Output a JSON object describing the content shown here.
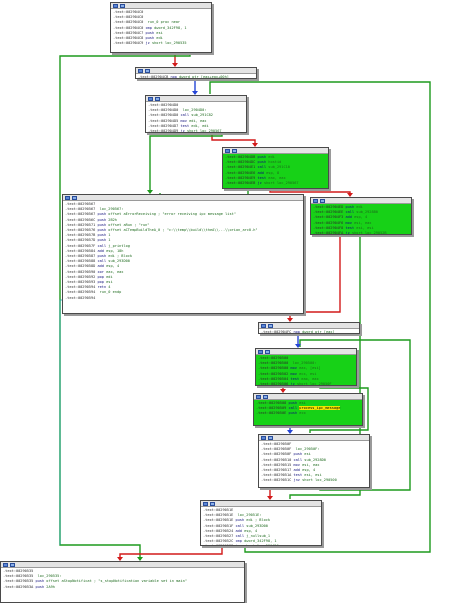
{
  "colors": {
    "edge_true": "#1d9a1d",
    "edge_false": "#d21a1a",
    "edge_uncond": "#2545d6",
    "node_green": "#17d117"
  },
  "nodes": [
    {
      "id": "n1",
      "green": false,
      "lines": [
        {
          "a": ".text:002904C0",
          "i": "",
          "o": ""
        },
        {
          "a": ".text:002904C0",
          "i": "",
          "o": ""
        },
        {
          "a": ".text:002904C0",
          "i": "",
          "o": "run_0 proc near"
        },
        {
          "a": ".text:002904C0",
          "i": "cmp",
          "o": "dword_342F98, 1"
        },
        {
          "a": ".text:002904C7",
          "i": "push",
          "o": "esi"
        },
        {
          "a": ".text:002904C8",
          "i": "push",
          "o": "edi"
        },
        {
          "a": ".text:002904C9",
          "i": "jz",
          "o": "short loc_290535"
        }
      ]
    },
    {
      "id": "n2",
      "green": false,
      "lines": [
        {
          "a": ".text:002904CB",
          "i": "nop",
          "o": "dword ptr [eax+eax+00h]"
        }
      ]
    },
    {
      "id": "n3",
      "green": false,
      "lines": [
        {
          "a": ".text:002904D0",
          "i": "",
          "o": ""
        },
        {
          "a": ".text:002904D0",
          "i": "",
          "o": "loc_2904D0:"
        },
        {
          "a": ".text:002904D0",
          "i": "call",
          "o": "sub_291C82"
        },
        {
          "a": ".text:002904D5",
          "i": "mov",
          "o": "edi, eax"
        },
        {
          "a": ".text:002904D7",
          "i": "test",
          "o": "edi, edi"
        },
        {
          "a": ".text:002904D9",
          "i": "jz",
          "o": "short loc_290567"
        }
      ]
    },
    {
      "id": "n4",
      "green": true,
      "lines": [
        {
          "a": ".text:002904DB",
          "i": "push",
          "o": "edi"
        },
        {
          "a": ".text:002904DC",
          "i": "push",
          "o": "hostid"
        },
        {
          "a": ".text:002904E1",
          "i": "call",
          "o": "sub_291C10"
        },
        {
          "a": ".text:002904E6",
          "i": "add",
          "o": "esp, 8"
        },
        {
          "a": ".text:002904E9",
          "i": "test",
          "o": "eax, eax"
        },
        {
          "a": ".text:002904EB",
          "i": "jz",
          "o": "short loc_290567"
        }
      ]
    },
    {
      "id": "n5",
      "green": false,
      "lines": [
        {
          "a": ".text:00290567",
          "i": "",
          "o": ""
        },
        {
          "a": ".text:00290567",
          "i": "",
          "o": "loc_290567:"
        },
        {
          "a": ".text:00290567",
          "i": "push",
          "o": "offset aErrorReceiving ; \"error receiving ipc message list\""
        },
        {
          "a": ".text:0029056C",
          "i": "push",
          "o": "2B2h"
        },
        {
          "a": ".text:00290571",
          "i": "push",
          "o": "offset aRun ; \"run\""
        },
        {
          "a": ".text:00290576",
          "i": "push",
          "o": "offset aCTempBuildTheA_0 ; \"c:\\\\temp\\\\build\\\\theA\\\\...\\\\orion_arc0.h\""
        },
        {
          "a": ".text:0029057B",
          "i": "push",
          "o": "1"
        },
        {
          "a": ".text:0029057D",
          "i": "push",
          "o": "1"
        },
        {
          "a": ".text:0029057F",
          "i": "call",
          "o": "j_printlog"
        },
        {
          "a": ".text:00290584",
          "i": "add",
          "o": "esp, 18h"
        },
        {
          "a": ".text:00290587",
          "i": "push",
          "o": "edi ; Block"
        },
        {
          "a": ".text:00290588",
          "i": "call",
          "o": "sub_293D00"
        },
        {
          "a": ".text:0029058D",
          "i": "add",
          "o": "esp, 4"
        },
        {
          "a": ".text:00290590",
          "i": "xor",
          "o": "eax, eax"
        },
        {
          "a": ".text:00290592",
          "i": "pop",
          "o": "edi"
        },
        {
          "a": ".text:00290593",
          "i": "pop",
          "o": "esi"
        },
        {
          "a": ".text:00290594",
          "i": "retn",
          "o": "4"
        },
        {
          "a": ".text:00290594",
          "i": "",
          "o": "run_0 endp"
        },
        {
          "a": ".text:00290594",
          "i": "",
          "o": ""
        }
      ]
    },
    {
      "id": "n6",
      "green": true,
      "lines": [
        {
          "a": ".text:002904ED",
          "i": "push",
          "o": "edi"
        },
        {
          "a": ".text:002904EE",
          "i": "call",
          "o": "sub_2928B0"
        },
        {
          "a": ".text:002904F3",
          "i": "add",
          "o": "esp, 4"
        },
        {
          "a": ".text:002904F6",
          "i": "mov",
          "o": "esi, eax"
        },
        {
          "a": ".text:002904F8",
          "i": "test",
          "o": "esi, esi"
        },
        {
          "a": ".text:002904FA",
          "i": "jz",
          "o": "short loc_29052B"
        }
      ]
    },
    {
      "id": "n7",
      "green": false,
      "lines": [
        {
          "a": ".text:002904FC",
          "i": "nop",
          "o": "dword ptr [eax]"
        }
      ]
    },
    {
      "id": "n8",
      "green": true,
      "lines": [
        {
          "a": ".text:00290500",
          "i": "",
          "o": ""
        },
        {
          "a": ".text:00290500",
          "i": "",
          "o": "loc_290500:"
        },
        {
          "a": ".text:00290500",
          "i": "mov",
          "o": "eax, [esi]"
        },
        {
          "a": ".text:00290502",
          "i": "mov",
          "o": "ecx, esi"
        },
        {
          "a": ".text:00290504",
          "i": "test",
          "o": "eax, eax"
        },
        {
          "a": ".text:00290506",
          "i": "jz",
          "o": "short loc_29050F"
        }
      ]
    },
    {
      "id": "n9",
      "green": true,
      "lines": [
        {
          "a": ".text:00290508",
          "i": "push",
          "o": "esi"
        },
        {
          "a": ".text:00290509",
          "i": "call",
          "o": "process_ipc_message",
          "h": true
        },
        {
          "a": ".text:0029050E",
          "i": "push",
          "o": "ecx"
        }
      ]
    },
    {
      "id": "n10",
      "green": false,
      "lines": [
        {
          "a": ".text:0029050F",
          "i": "",
          "o": ""
        },
        {
          "a": ".text:0029050F",
          "i": "",
          "o": "loc_29050F:"
        },
        {
          "a": ".text:0029050F",
          "i": "push",
          "o": "esi"
        },
        {
          "a": ".text:00290510",
          "i": "call",
          "o": "sub_2928D0"
        },
        {
          "a": ".text:00290515",
          "i": "mov",
          "o": "esi, eax"
        },
        {
          "a": ".text:00290517",
          "i": "add",
          "o": "esp, 4"
        },
        {
          "a": ".text:0029051A",
          "i": "test",
          "o": "esi, esi"
        },
        {
          "a": ".text:0029051C",
          "i": "jnz",
          "o": "short loc_290500"
        }
      ]
    },
    {
      "id": "n11",
      "green": false,
      "lines": [
        {
          "a": ".text:0029051E",
          "i": "",
          "o": ""
        },
        {
          "a": ".text:0029051E",
          "i": "",
          "o": "loc_29051E:"
        },
        {
          "a": ".text:0029051E",
          "i": "push",
          "o": "edi ; Block"
        },
        {
          "a": ".text:0029051F",
          "i": "call",
          "o": "sub_293D00"
        },
        {
          "a": ".text:00290524",
          "i": "add",
          "o": "esp, 4"
        },
        {
          "a": ".text:00290527",
          "i": "call",
          "o": "j_nullsub_1"
        },
        {
          "a": ".text:0029052C",
          "i": "cmp",
          "o": "dword_342F98, 1"
        },
        {
          "a": ".text:00290533",
          "i": "jnz",
          "o": "short loc_2904D0"
        }
      ]
    },
    {
      "id": "n12",
      "green": false,
      "lines": [
        {
          "a": ".text:00290535",
          "i": "",
          "o": ""
        },
        {
          "a": ".text:00290535",
          "i": "",
          "o": "loc_290535:"
        },
        {
          "a": ".text:00290535",
          "i": "push",
          "o": "offset aStopNotificat ; \"s_stopNotification variable set in main\""
        },
        {
          "a": ".text:0029053A",
          "i": "push",
          "o": "2A9h"
        }
      ]
    }
  ]
}
